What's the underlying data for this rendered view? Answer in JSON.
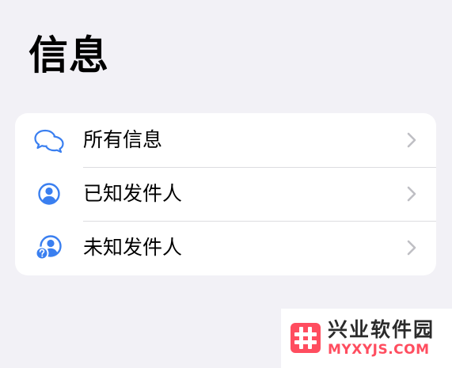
{
  "page": {
    "title": "信息"
  },
  "list": {
    "items": [
      {
        "label": "所有信息",
        "icon": "chat-bubbles-icon"
      },
      {
        "label": "已知发件人",
        "icon": "person-circle-icon"
      },
      {
        "label": "未知发件人",
        "icon": "unknown-person-icon"
      }
    ]
  },
  "watermark": {
    "title": "兴业软件园",
    "url": "MYXYJS.COM"
  },
  "colors": {
    "background": "#f2f1f6",
    "card": "#ffffff",
    "accent": "#3a7ff0",
    "chevron": "#bfbfc4",
    "watermark_accent": "#ff4d5f"
  }
}
